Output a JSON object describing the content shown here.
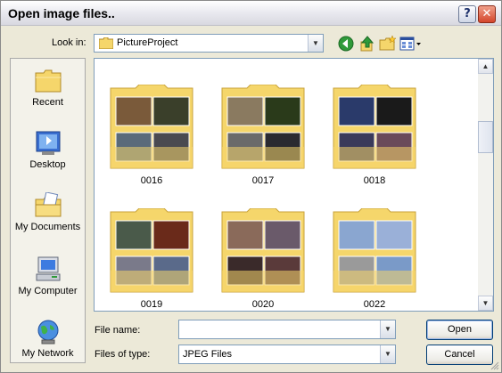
{
  "window": {
    "title": "Open image files.."
  },
  "titlebar": {
    "help": "?",
    "close": "✕"
  },
  "lookin": {
    "label": "Look in:",
    "value": "PictureProject"
  },
  "places": [
    {
      "label": "Recent"
    },
    {
      "label": "Desktop"
    },
    {
      "label": "My Documents"
    },
    {
      "label": "My Computer"
    },
    {
      "label": "My Network"
    }
  ],
  "folders": [
    {
      "name": "0016"
    },
    {
      "name": "0017"
    },
    {
      "name": "0018"
    },
    {
      "name": "0019"
    },
    {
      "name": "0020"
    },
    {
      "name": "0022"
    }
  ],
  "filename": {
    "label": "File name:",
    "value": ""
  },
  "filetype": {
    "label": "Files of type:",
    "value": "JPEG Files"
  },
  "buttons": {
    "open": "Open",
    "cancel": "Cancel"
  },
  "colors": {
    "folder": "#f5d66b",
    "folder_edge": "#c8a23a",
    "accent": "#003c74",
    "back_arrow": "#2f9a3a"
  }
}
